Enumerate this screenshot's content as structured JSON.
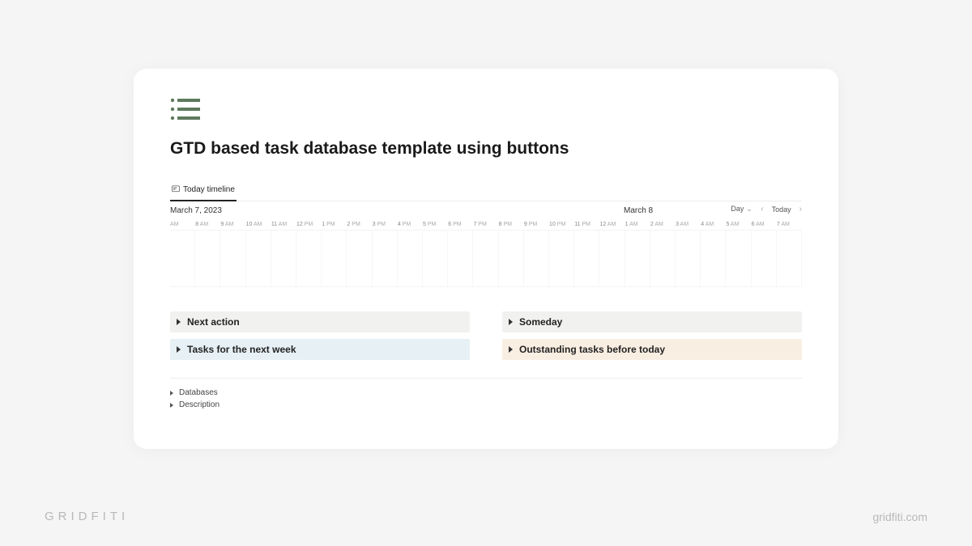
{
  "brand": {
    "left": "GRIDFITI",
    "right": "gridfiti.com"
  },
  "page": {
    "title": "GTD based task database template using buttons",
    "icon_color": "#5e7a5e"
  },
  "tab": {
    "label": "Today timeline"
  },
  "timeline": {
    "date_primary": "March 7, 2023",
    "date_secondary": "March 8",
    "view_label": "Day",
    "today_label": "Today",
    "hours": [
      {
        "n": "",
        "s": "AM"
      },
      {
        "n": "8",
        "s": "AM"
      },
      {
        "n": "9",
        "s": "AM"
      },
      {
        "n": "10",
        "s": "AM"
      },
      {
        "n": "11",
        "s": "AM"
      },
      {
        "n": "12",
        "s": "PM"
      },
      {
        "n": "1",
        "s": "PM"
      },
      {
        "n": "2",
        "s": "PM"
      },
      {
        "n": "3",
        "s": "PM"
      },
      {
        "n": "4",
        "s": "PM"
      },
      {
        "n": "5",
        "s": "PM"
      },
      {
        "n": "6",
        "s": "PM"
      },
      {
        "n": "7",
        "s": "PM"
      },
      {
        "n": "8",
        "s": "PM"
      },
      {
        "n": "9",
        "s": "PM"
      },
      {
        "n": "10",
        "s": "PM"
      },
      {
        "n": "11",
        "s": "PM"
      },
      {
        "n": "12",
        "s": "AM"
      },
      {
        "n": "1",
        "s": "AM"
      },
      {
        "n": "2",
        "s": "AM"
      },
      {
        "n": "3",
        "s": "AM"
      },
      {
        "n": "4",
        "s": "AM"
      },
      {
        "n": "5",
        "s": "AM"
      },
      {
        "n": "6",
        "s": "AM"
      },
      {
        "n": "7",
        "s": "AM"
      }
    ]
  },
  "sections": {
    "next_action": "Next action",
    "someday": "Someday",
    "tasks_next_week": "Tasks for the next week",
    "outstanding": "Outstanding tasks before today"
  },
  "footer_toggles": {
    "databases": "Databases",
    "description": "Description"
  }
}
